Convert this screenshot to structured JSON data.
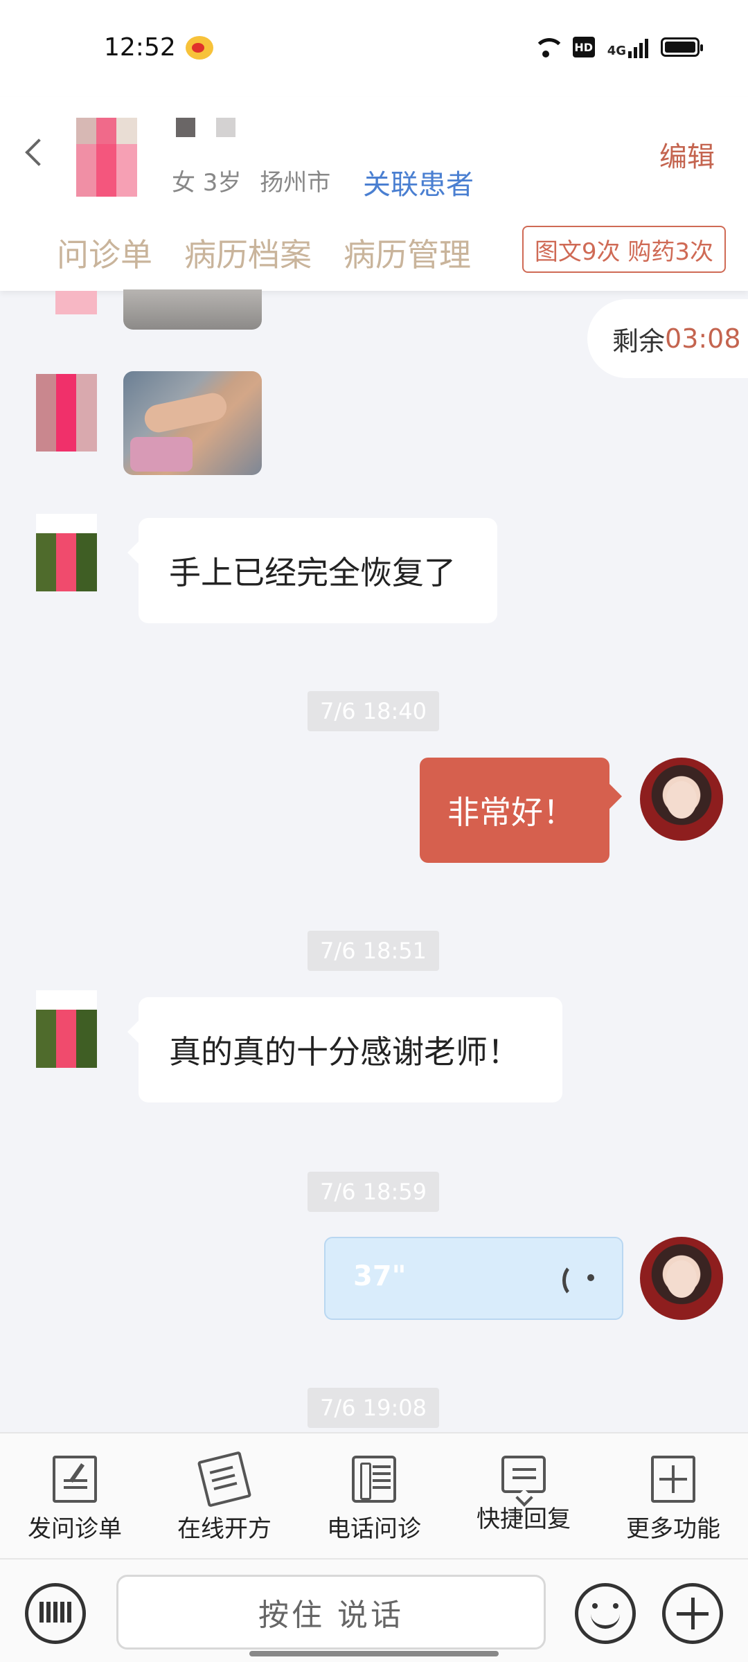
{
  "status_bar": {
    "time": "12:52",
    "network": "4G",
    "hd": "HD"
  },
  "header": {
    "patient_meta": [
      "女 3岁",
      "扬州市"
    ],
    "link_patient": "关联患者",
    "edit": "编辑",
    "tabs": [
      "问诊单",
      "病历档案",
      "病历管理"
    ],
    "badge": "图文9次 购药3次"
  },
  "chat": {
    "remaining_label": "剩余",
    "remaining_time": "03:08",
    "messages": {
      "m1": "手上已经完全恢复了",
      "m2": "非常好！",
      "m3": "真的真的十分感谢老师！",
      "voice_duration": "37\""
    },
    "timestamps": [
      "7/6 18:40",
      "7/6 18:51",
      "7/6 18:59",
      "7/6 19:08"
    ]
  },
  "toolbar": {
    "items": [
      "发问诊单",
      "在线开方",
      "电话问诊",
      "快捷回复",
      "更多功能"
    ]
  },
  "input": {
    "hold_to_talk": "按住 说话"
  },
  "colors": {
    "accent": "#d6604e",
    "link": "#4a7fd1",
    "tab_text": "#c9b49b"
  }
}
